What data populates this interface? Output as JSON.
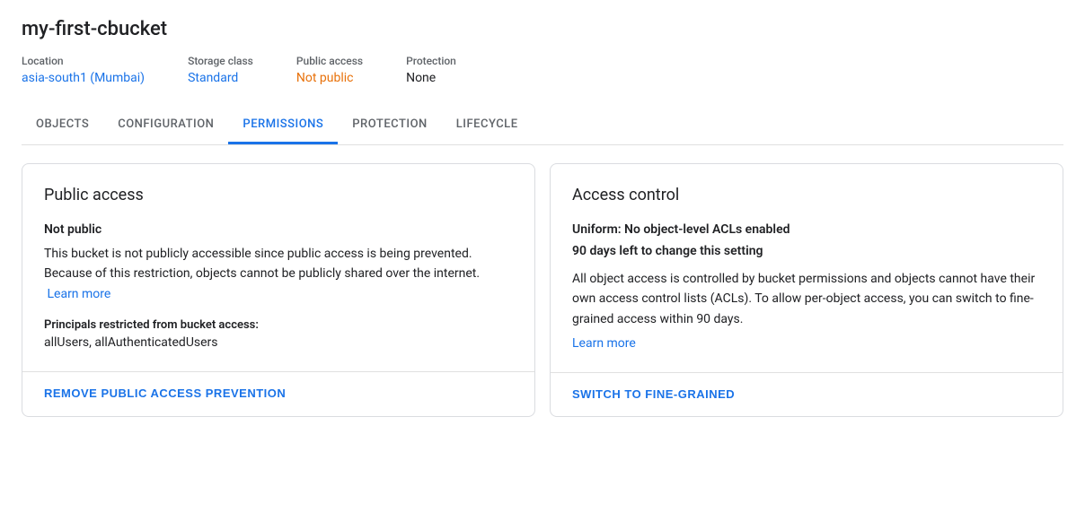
{
  "page": {
    "title": "my-first-cbucket"
  },
  "bucket_meta": {
    "location": {
      "label": "Location",
      "value": "asia-south1 (Mumbai)"
    },
    "storage_class": {
      "label": "Storage class",
      "value": "Standard"
    },
    "public_access": {
      "label": "Public access",
      "value": "Not public"
    },
    "protection": {
      "label": "Protection",
      "value": "None"
    }
  },
  "tabs": [
    {
      "id": "objects",
      "label": "OBJECTS",
      "active": false
    },
    {
      "id": "configuration",
      "label": "CONFIGURATION",
      "active": false
    },
    {
      "id": "permissions",
      "label": "PERMISSIONS",
      "active": true
    },
    {
      "id": "protection",
      "label": "PROTECTION",
      "active": false
    },
    {
      "id": "lifecycle",
      "label": "LIFECYCLE",
      "active": false
    }
  ],
  "public_access_card": {
    "title": "Public access",
    "subtitle": "Not public",
    "description": "This bucket is not publicly accessible since public access is being prevented. Because of this restriction, objects cannot be publicly shared over the internet.",
    "learn_more_text": "Learn more",
    "principals_label": "Principals restricted from bucket access:",
    "principals_value": "allUsers, allAuthenticatedUsers",
    "action_button": "REMOVE PUBLIC ACCESS PREVENTION"
  },
  "access_control_card": {
    "title": "Access control",
    "subtitle": "Uniform: No object-level ACLs enabled",
    "days_notice": "90 days left to change this setting",
    "description": "All object access is controlled by bucket permissions and objects cannot have their own access control lists (ACLs). To allow per-object access, you can switch to fine-grained access within 90 days.",
    "learn_more_text": "Learn more",
    "action_button": "SWITCH TO FINE-GRAINED"
  }
}
